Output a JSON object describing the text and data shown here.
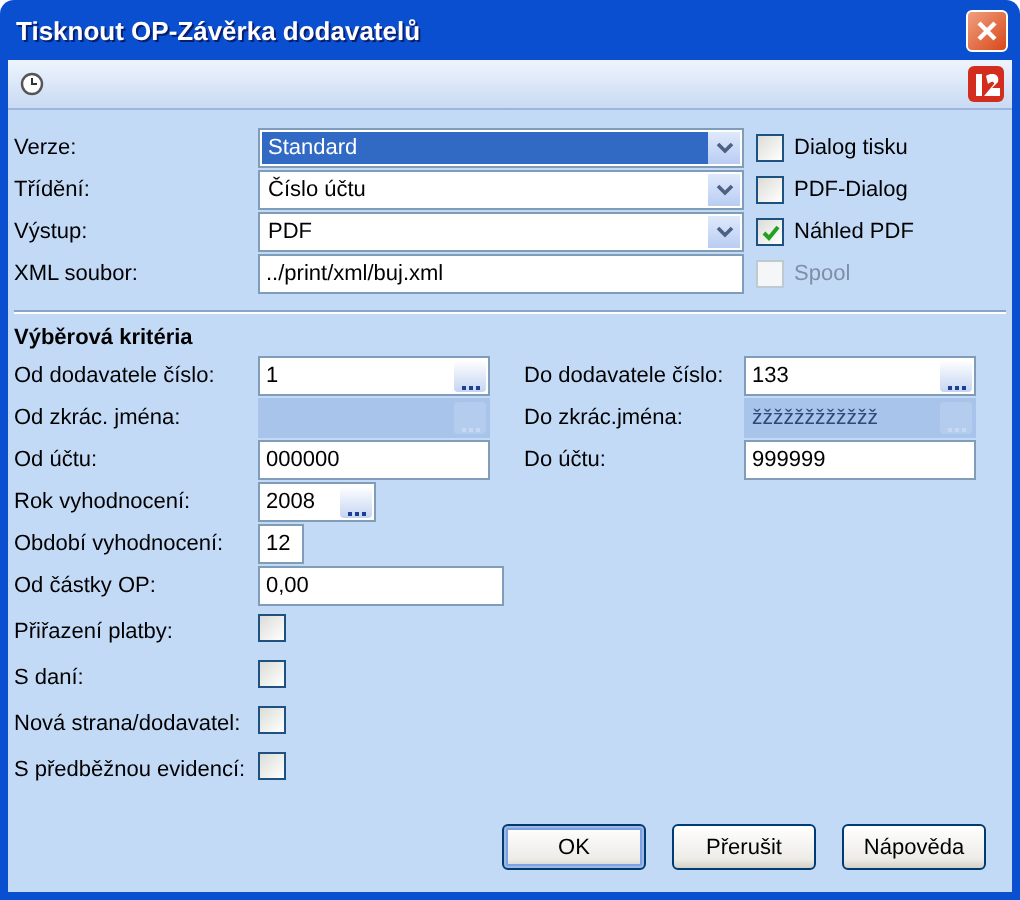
{
  "window": {
    "title": "Tisknout OP-Závěrka dodavatelů"
  },
  "top_rows": [
    {
      "label": "Verze:",
      "kind": "combo",
      "value": "Standard",
      "selected": true,
      "option": {
        "label": "Dialog tisku",
        "checked": false,
        "disabled": false
      }
    },
    {
      "label": "Třídění:",
      "kind": "combo",
      "value": "Číslo účtu",
      "selected": false,
      "option": {
        "label": "PDF-Dialog",
        "checked": false,
        "disabled": false
      }
    },
    {
      "label": "Výstup:",
      "kind": "combo",
      "value": "PDF",
      "selected": false,
      "option": {
        "label": "Náhled PDF",
        "checked": true,
        "disabled": false
      }
    },
    {
      "label": "XML soubor:",
      "kind": "text",
      "value": "../print/xml/buj.xml",
      "selected": false,
      "option": {
        "label": "Spool",
        "checked": false,
        "disabled": true
      }
    }
  ],
  "criteria": {
    "title": "Výběrová kritéria",
    "rows": [
      {
        "left": {
          "label": "Od dodavatele číslo:",
          "value": "1",
          "kind": "lookup",
          "disabled": false
        },
        "right": {
          "label": "Do dodavatele číslo:",
          "value": "133",
          "kind": "lookup",
          "disabled": false
        }
      },
      {
        "left": {
          "label": "Od zkrác. jména:",
          "kind": "lookup",
          "disabled": true
        },
        "right": {
          "label": "Do zkrác.jména:",
          "value": "žžžžžžžžžžžž",
          "kind": "lookup",
          "disabled": true
        }
      },
      {
        "left": {
          "label": "Od účtu:",
          "value": "000000",
          "kind": "text",
          "disabled": false
        },
        "right": {
          "label": "Do účtu:",
          "value": "999999",
          "kind": "text",
          "disabled": false
        }
      },
      {
        "left": {
          "label": "Rok vyhodnocení:",
          "value": "2008",
          "kind": "lookup",
          "disabled": false
        }
      },
      {
        "left": {
          "label": "Období vyhodnocení:",
          "value": "12",
          "kind": "text",
          "disabled": false
        }
      },
      {
        "left": {
          "label": "Od částky OP:",
          "value": "0,00",
          "kind": "text",
          "disabled": false
        }
      }
    ],
    "checks": [
      {
        "label": "Přiřazení platby:",
        "checked": false
      },
      {
        "label": "S daní:",
        "checked": false
      },
      {
        "label": "Nová strana/dodavatel:",
        "checked": false
      },
      {
        "label": "S předběžnou evidencí:",
        "checked": false
      }
    ]
  },
  "buttons": [
    {
      "label": "OK",
      "default": true
    },
    {
      "label": "Přerušit",
      "default": false
    },
    {
      "label": "Nápověda",
      "default": false
    }
  ]
}
